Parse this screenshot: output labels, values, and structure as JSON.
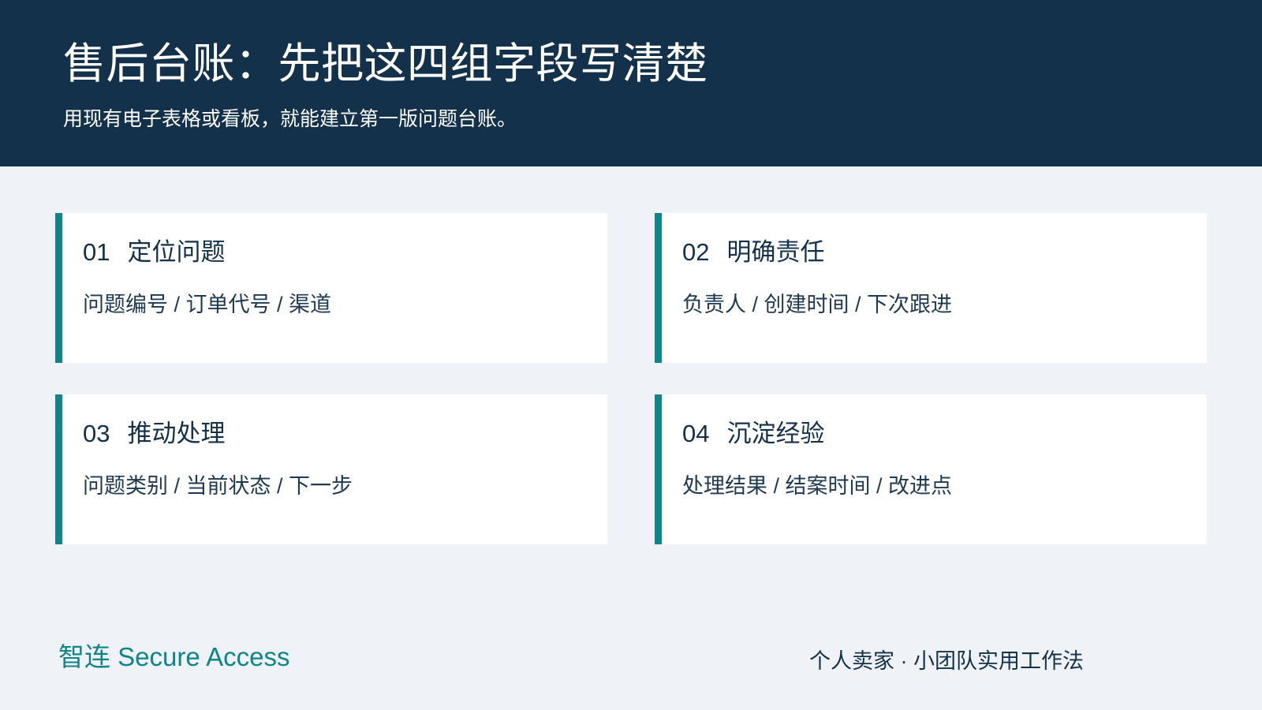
{
  "header": {
    "title": "售后台账：先把这四组字段写清楚",
    "subtitle": "用现有电子表格或看板，就能建立第一版问题台账。"
  },
  "cards": [
    {
      "number": "01",
      "title": "定位问题",
      "fields": "问题编号 / 订单代号 / 渠道"
    },
    {
      "number": "02",
      "title": "明确责任",
      "fields": "负责人 / 创建时间 / 下次跟进"
    },
    {
      "number": "03",
      "title": "推动处理",
      "fields": "问题类别 / 当前状态 / 下一步"
    },
    {
      "number": "04",
      "title": "沉淀经验",
      "fields": "处理结果 / 结案时间 / 改进点"
    }
  ],
  "footer": {
    "brand": "智连 Secure Access",
    "tagline": "个人卖家 · 小团队实用工作法"
  },
  "colors": {
    "header_bg": "#13314b",
    "page_bg": "#eff3f7",
    "accent": "#0f858b",
    "card_bg": "#ffffff",
    "text_dark": "#13314b"
  }
}
